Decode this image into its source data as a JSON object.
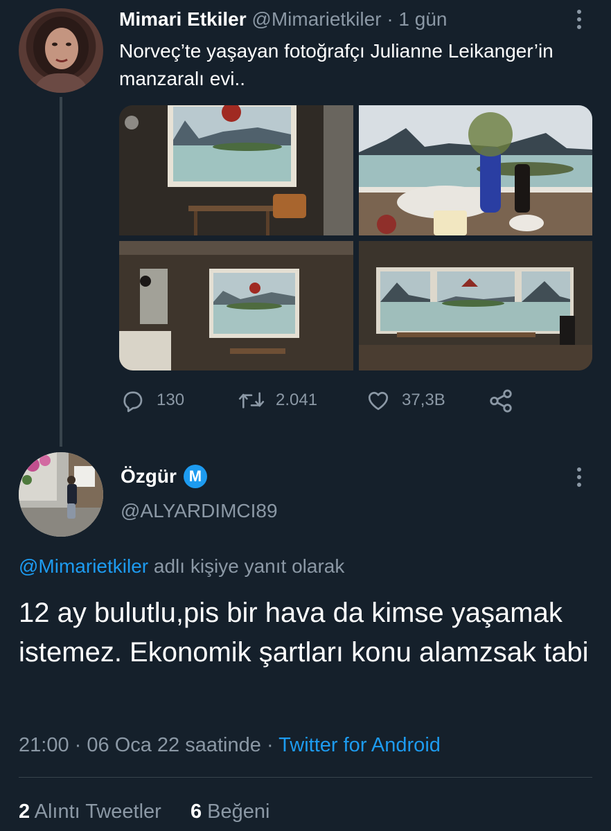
{
  "tweet": {
    "author_name": "Mimari Etkiler",
    "author_handle": "@Mimarietkiler",
    "separator": "·",
    "time_ago": "1 gün",
    "text": "Norveç’te yaşayan fotoğrafçı Julianne Leikanger’in manzaralı evi..",
    "media_count": 4,
    "actions": {
      "replies": "130",
      "retweets": "2.041",
      "likes": "37,3B"
    }
  },
  "reply": {
    "author_name": "Özgür",
    "badge_letter": "M",
    "author_handle": "@ALYARDIMCI89",
    "reply_to_handle": "@Mimarietkiler",
    "reply_to_suffix": " adlı kişiye yanıt olarak",
    "text": "12 ay bulutlu,pis bir hava da kimse yaşamak istemez. Ekonomik şartları konu alamzsak tabi",
    "time": "21:00",
    "date": "06 Oca 22 saatinde",
    "separator": "·",
    "source": "Twitter for Android",
    "quote_count": "2",
    "quote_label": " Alıntı Tweetler",
    "like_count": "6",
    "like_label": " Beğeni"
  },
  "colors": {
    "background": "#15202b",
    "muted": "#8b98a5",
    "accent": "#1d9bf0",
    "divider": "#38444d"
  }
}
